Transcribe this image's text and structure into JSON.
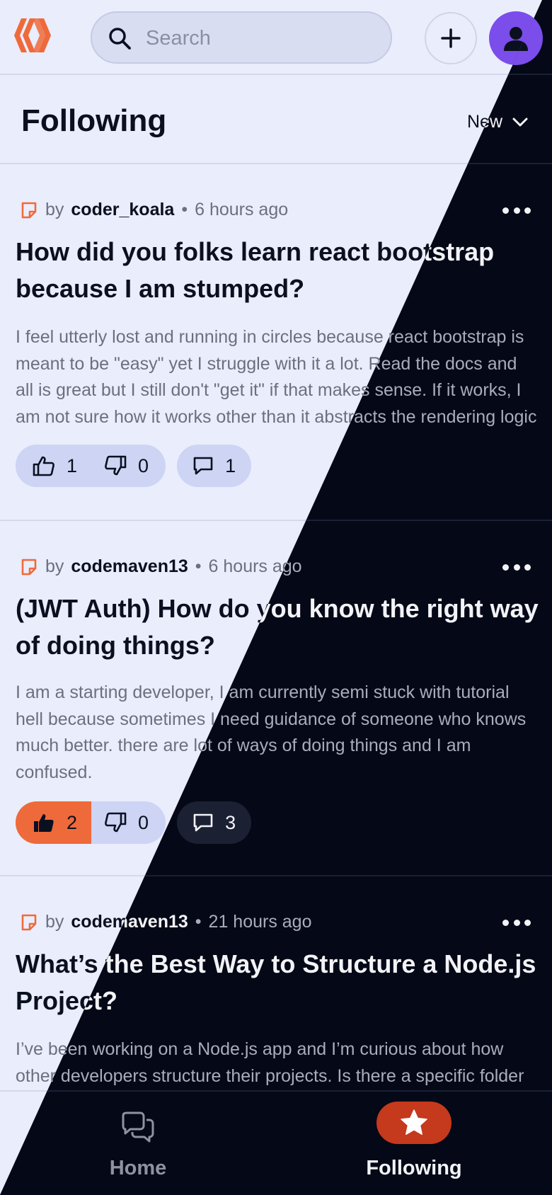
{
  "header": {
    "logo_name": "hive-logo",
    "search_placeholder": "Search",
    "create_button": "+",
    "avatar_icon": "user-icon"
  },
  "feed": {
    "title": "Following",
    "sort_label": "New"
  },
  "posts": [
    {
      "by": "by",
      "author": "coder_koala",
      "time": "6 hours ago",
      "title": "How did you folks learn react bootstrap because I am stumped?",
      "body": "I feel utterly lost and running in circles because react bootstrap is meant to be \"easy\" yet I struggle with it a lot. Read the docs and all is great but I still don't \"get it\" if that makes sense. If it works, I am not sure how it works other than it abstracts the rendering logic",
      "upvotes": "1",
      "downvotes": "0",
      "comments": "1",
      "upvoted": false
    },
    {
      "by": "by",
      "author": "codemaven13",
      "time": "6 hours ago",
      "title": "(JWT Auth) How do you know the right way of doing things?",
      "body": "I am a starting developer, I am currently semi stuck with tutorial hell because sometimes I need guidance of someone who knows much better. there are lot of ways of doing things and I am confused.",
      "upvotes": "2",
      "downvotes": "0",
      "comments": "3",
      "upvoted": true
    },
    {
      "by": "by",
      "author": "codemaven13",
      "time": "21 hours ago",
      "title": "What’s the Best Way to Structure a Node.js Project?",
      "body": "I’ve been working on a Node.js app and I’m curious about how other developers structure their projects. Is there a specific folder"
    }
  ],
  "bottom_nav": {
    "home_label": "Home",
    "following_label": "Following"
  },
  "colors": {
    "accent": "#ef6a3a",
    "nav_active": "#c5391c",
    "avatar": "#7b4dea",
    "light_bg": "#eaedfc",
    "dark_bg": "#050816"
  }
}
